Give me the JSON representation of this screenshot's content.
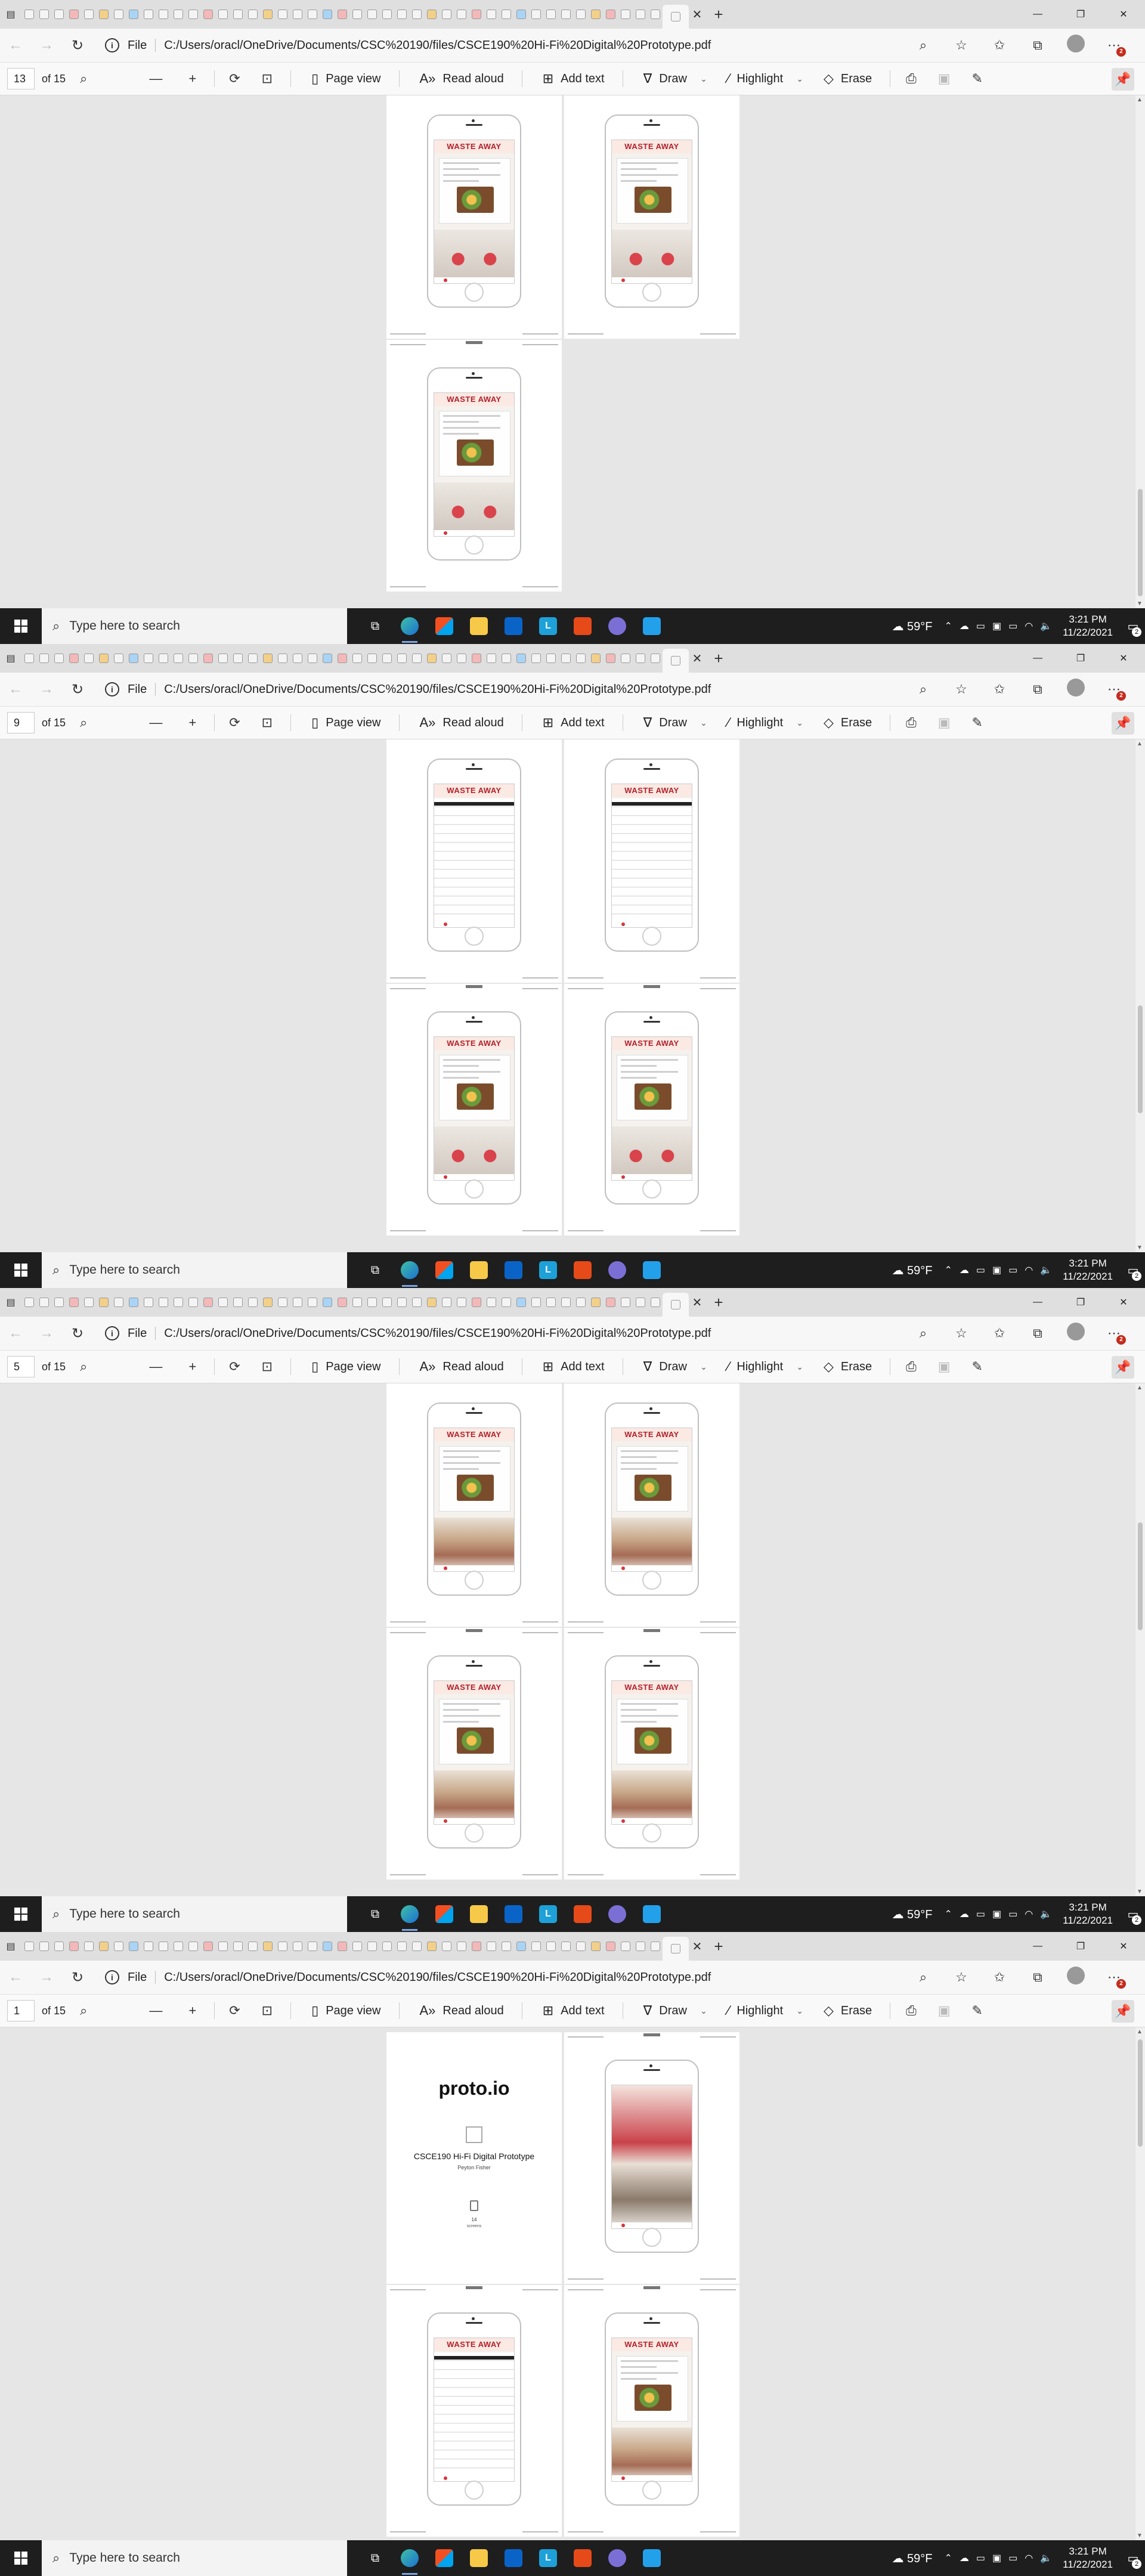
{
  "browser": {
    "url": "C:/Users/oracl/OneDrive/Documents/CSC%20190/files/CSCE190%20Hi-Fi%20Digital%20Prototype.pdf",
    "file_label": "File"
  },
  "pdf_toolbar": {
    "of_total": "of 15",
    "page_view": "Page view",
    "read_aloud": "Read aloud",
    "add_text": "Add text",
    "draw": "Draw",
    "highlight": "Highlight",
    "erase": "Erase"
  },
  "taskbar": {
    "search_placeholder": "Type here to search",
    "weather": "59°F",
    "time": "3:21 PM",
    "date": "11/22/2021",
    "notification_count": "2"
  },
  "document": {
    "app_brand": "WASTE AWAY",
    "cover_logo": "proto.io",
    "cover_title": "CSCE190 Hi-Fi Digital Prototype",
    "cover_author": "Peyton Fisher",
    "cover_count": "14",
    "cover_screens_label": "screens"
  },
  "panels": [
    {
      "page_number": "13",
      "scroll_top_pct": 0.78,
      "scroll_height_pct": 0.22
    },
    {
      "page_number": "9",
      "scroll_top_pct": 0.52,
      "scroll_height_pct": 0.22
    },
    {
      "page_number": "5",
      "scroll_top_pct": 0.26,
      "scroll_height_pct": 0.22
    },
    {
      "page_number": "1",
      "scroll_top_pct": 0.0,
      "scroll_height_pct": 0.22
    }
  ],
  "colors": {
    "brand_red": "#b3202a",
    "taskbar": "#1e1e1e",
    "content_bg": "#e6e6e6"
  },
  "icons": {
    "back": "arrow-left-icon",
    "forward": "arrow-right-icon",
    "refresh": "refresh-icon",
    "zoom_out": "minus-icon",
    "zoom_in": "plus-icon",
    "rotate": "rotate-icon",
    "fit": "fit-page-icon",
    "print": "print-icon",
    "save": "save-icon",
    "save_as": "save-as-icon",
    "pin": "pin-icon"
  }
}
